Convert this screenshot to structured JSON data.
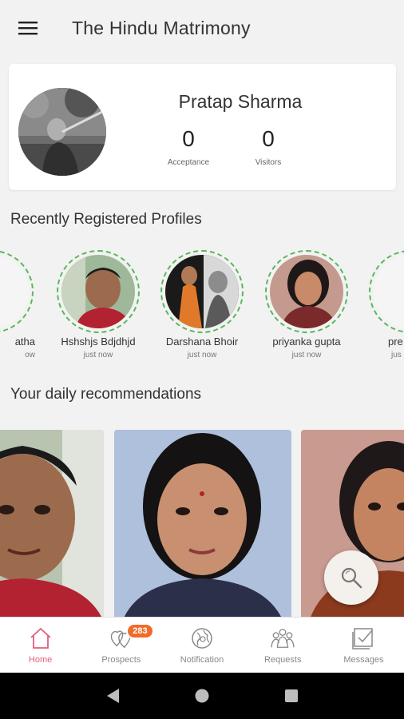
{
  "header": {
    "title": "The Hindu Matrimony"
  },
  "profile": {
    "name": "Pratap Sharma",
    "acceptance_value": "0",
    "acceptance_label": "Acceptance",
    "visitors_value": "0",
    "visitors_label": "Visitors"
  },
  "recent": {
    "title": "Recently Registered Profiles",
    "items": [
      {
        "name": "atha",
        "time": "ow"
      },
      {
        "name": "Hshshjs Bdjdhjd",
        "time": "just now"
      },
      {
        "name": "Darshana Bhoir",
        "time": "just now"
      },
      {
        "name": "priyanka gupta",
        "time": "just now"
      },
      {
        "name": "pre",
        "time": "jus"
      }
    ]
  },
  "daily": {
    "title": "Your daily recommendations"
  },
  "nav": {
    "items": [
      {
        "label": "Home",
        "icon": "home-icon",
        "active": true
      },
      {
        "label": "Prospects",
        "icon": "hearts-icon",
        "badge": "283"
      },
      {
        "label": "Notification",
        "icon": "globe-icon"
      },
      {
        "label": "Requests",
        "icon": "people-icon"
      },
      {
        "label": "Messages",
        "icon": "message-icon"
      }
    ]
  },
  "colors": {
    "accent": "#e25f7c",
    "ring": "#57b85a",
    "badge": "#f06b2a"
  }
}
